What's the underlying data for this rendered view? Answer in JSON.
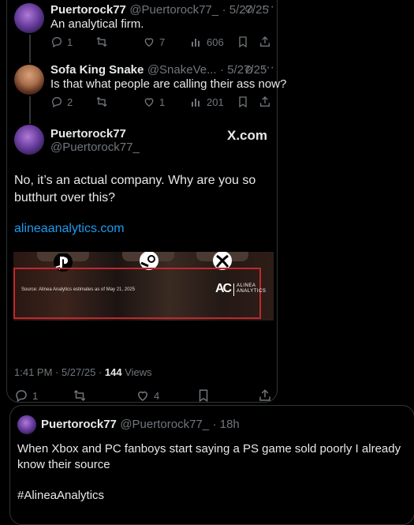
{
  "tweets": [
    {
      "name": "Puertorock77",
      "handle": "@Puertorock77_",
      "date": "· 5/27/25",
      "text": "An analytical firm.",
      "replies": "1",
      "retweets": "",
      "likes": "7",
      "views": "606"
    },
    {
      "name": "Sofa King Snake",
      "handle": "@SnakeVe...",
      "date": "· 5/27/25",
      "text": "Is that what people are calling their ass now?",
      "replies": "2",
      "retweets": "",
      "likes": "1",
      "views": "201"
    }
  ],
  "main_tweet": {
    "name": "Puertorock77",
    "handle": "@Puertorock77_",
    "brand": "X.com",
    "text": "No, it’s an actual company. Why are you so butthurt over this?",
    "link": "alineaanalytics.com",
    "media": {
      "source_text": "Source: Alinea Analytics estimates as of May 21, 2025",
      "logo_mark": "AC",
      "logo_text_1": "ALINEA",
      "logo_text_2": "ANALYTICS"
    },
    "time": "1:41 PM · 5/27/25 ·",
    "views_count": "144",
    "views_label": "Views",
    "replies": "1",
    "likes": "4"
  },
  "quote_tweet": {
    "name": "Puertorock77",
    "handle": "@Puertorock77_",
    "date": "· 18h",
    "text": "When Xbox and PC fanboys start saying a PS game sold poorly I already know their source",
    "hashtag": "#AlineaAnalytics"
  },
  "colors": {
    "link": "#1d9bf0",
    "muted": "#71767b",
    "border": "#2f3336",
    "highlight_box": "#c0282d"
  }
}
